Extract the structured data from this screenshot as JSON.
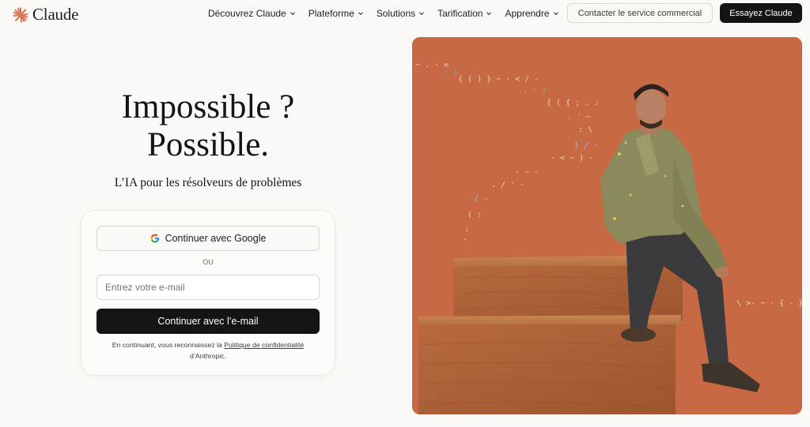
{
  "header": {
    "brand": "Claude",
    "logo_icon": "claude-starburst-icon",
    "nav": [
      {
        "label": "Découvrez Claude",
        "icon": "chevron-down-icon"
      },
      {
        "label": "Plateforme",
        "icon": "chevron-down-icon"
      },
      {
        "label": "Solutions",
        "icon": "chevron-down-icon"
      },
      {
        "label": "Tarification",
        "icon": "chevron-down-icon"
      },
      {
        "label": "Apprendre",
        "icon": "chevron-down-icon"
      }
    ],
    "contact_label": "Contacter le service commercial",
    "try_label": "Essayez Claude"
  },
  "hero": {
    "title_line1": "Impossible ?",
    "title_line2": "Possible.",
    "subtitle": "L’IA pour les résolveurs de problèmes"
  },
  "signin": {
    "google_label": "Continuer avec Google",
    "google_icon": "google-g-icon",
    "or_label": "OU",
    "email_placeholder": "Entrez votre e-mail",
    "email_value": "",
    "email_button_label": "Continuer avec l’e-mail",
    "legal_prefix": "En continuant, vous reconnaissez la ",
    "legal_link": "Politique de confidentialité",
    "legal_suffix": " d’Anthropic."
  },
  "colors": {
    "background": "#faf9f5",
    "accent_brand": "#d97757",
    "button_dark": "#141413",
    "hero_image_bg": "#c76a43"
  }
}
